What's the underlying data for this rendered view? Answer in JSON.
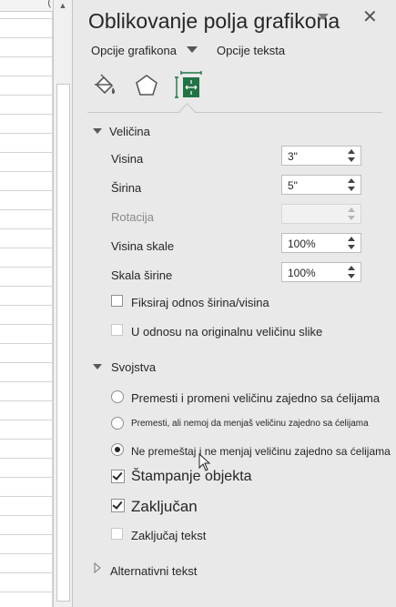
{
  "spreadsheet": {
    "column_header_partial": "("
  },
  "pane": {
    "title": "Oblikovanje polja grafikona",
    "tabs": {
      "chart_options": "Opcije grafikona",
      "text_options": "Opcije teksta"
    },
    "icons": [
      "fill-line-icon",
      "effects-icon",
      "size-properties-icon"
    ],
    "colors": {
      "pane_bg": "#e9e9e9",
      "text": "#262626",
      "active_icon": "#217346"
    }
  },
  "size_section": {
    "heading": "Veličina",
    "rows": [
      {
        "label": "Visina",
        "value": "3\""
      },
      {
        "label": "Širina",
        "value": "5\""
      },
      {
        "label": "Rotacija",
        "value": ""
      },
      {
        "label": "Visina skale",
        "value": "100%"
      },
      {
        "label": "Skala širine",
        "value": "100%"
      }
    ],
    "lock_aspect": "Fiksiraj odnos širina/visina",
    "relative_original": "U odnosu na originalnu veličinu slike"
  },
  "properties_section": {
    "heading": "Svojstva",
    "radio_options": [
      "Premesti i promeni veličinu zajedno sa ćelijama",
      "Premesti, ali nemoj da menjaš veličinu zajedno sa ćelijama",
      "Ne premeštaj i ne menjaj veličinu zajedno sa ćelijama"
    ],
    "selected_radio": 2,
    "print_object": "Štampanje objekta",
    "locked": "Zaključan",
    "lock_text": "Zaključaj tekst"
  },
  "alt_text_section": {
    "heading": "Alternativni tekst"
  }
}
